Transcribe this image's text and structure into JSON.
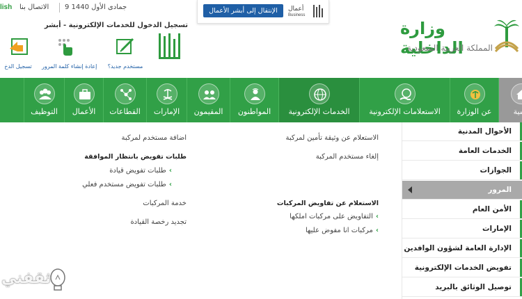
{
  "topbar": {
    "english_link": "lish",
    "contact": "الاتصال بنا",
    "date": "9 جمادى الأول 1440"
  },
  "business": {
    "button_label": "الإنتقال إلى أبشر الأعمال",
    "logo_line1": "أعمال",
    "logo_line2": "Business"
  },
  "login": {
    "title": "تسجيل الدخول للخدمات الإلكترونية - أبشر",
    "items": [
      {
        "label": "مستخدم جديد؟",
        "icon": "new-user-icon"
      },
      {
        "label": "إعادة إنشاء كلمة المرور",
        "icon": "password-reset-icon"
      },
      {
        "label": "تسجيل الدخ",
        "icon": "login-icon"
      }
    ]
  },
  "ministry": {
    "name": "وزارة الداخلية",
    "subtitle": "المملكة العربية السعودية"
  },
  "nav": {
    "items": [
      {
        "label": "التوظيف",
        "icon": "group-icon"
      },
      {
        "label": "الأعمال",
        "icon": "briefcase-icon"
      },
      {
        "label": "القطاعات",
        "icon": "network-icon"
      },
      {
        "label": "الإمارات",
        "icon": "emblem-icon"
      },
      {
        "label": "المقيمون",
        "icon": "residents-icon"
      },
      {
        "label": "المواطنون",
        "icon": "citizen-icon"
      },
      {
        "label": "الخدمات الإلكترونية",
        "icon": "globe-icon"
      },
      {
        "label": "الاستعلامات الإلكترونية",
        "icon": "globe-hand-icon"
      },
      {
        "label": "عن الوزارة",
        "icon": "ministry-icon"
      },
      {
        "label": "سية",
        "icon": "home-icon"
      }
    ]
  },
  "mega": {
    "col_right": {
      "link1": "الاستعلام عن وثيقة تأمين لمركبة",
      "link2": "إلغاء مستخدم المركبة",
      "heading": "الاستعلام عن تفاويض المركبات",
      "sub1": "التفاويض على مركبات املكها",
      "sub2": "مركبات انا مفوض عليها"
    },
    "col_left": {
      "link1": "اضافة مستخدم لمركبة",
      "heading": "طلبات تفويض بانتظار الموافقة",
      "sub1": "طلبات تفويض قيادة",
      "sub2": "طلبات تفويض مستخدم فعلي",
      "link2": "خدمة المركبات",
      "link3": "تجديد رخصة القيادة"
    }
  },
  "sidebar": {
    "items": [
      {
        "label": "الأحوال المدنية"
      },
      {
        "label": "الخدمات العامة"
      },
      {
        "label": "الجوازات"
      },
      {
        "label": "المرور"
      },
      {
        "label": "الأمن العام"
      },
      {
        "label": "الإمارات"
      },
      {
        "label": "الإدارة العامة لشؤون الوافدين"
      },
      {
        "label": "تفويض الخدمات الإلكترونية"
      },
      {
        "label": "توصيل الوثائق بالبريد"
      }
    ]
  },
  "watermark": {
    "text": "ثقفني"
  },
  "colors": {
    "green": "#31a047",
    "blue": "#1f5fa6",
    "active_gray": "#a9a9a9"
  }
}
